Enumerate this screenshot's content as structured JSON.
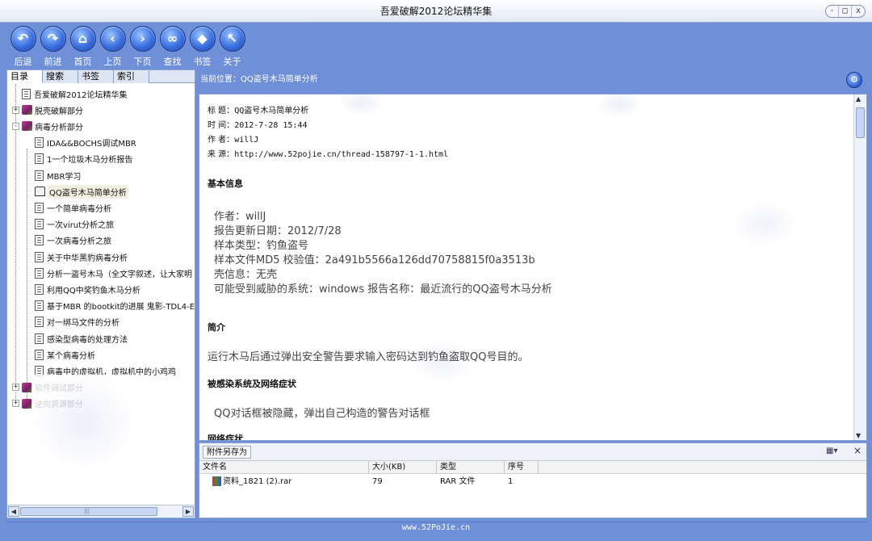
{
  "window": {
    "title": "吾爱破解2012论坛精华集",
    "controls": [
      "-",
      "□",
      "x"
    ]
  },
  "toolbar": [
    {
      "label": "后退",
      "icon": "back-icon",
      "glyph": "↶"
    },
    {
      "label": "前进",
      "icon": "forward-icon",
      "glyph": "↷"
    },
    {
      "label": "首页",
      "icon": "home-icon",
      "glyph": "⌂"
    },
    {
      "label": "上页",
      "icon": "prev-page-icon",
      "glyph": "‹"
    },
    {
      "label": "下页",
      "icon": "next-page-icon",
      "glyph": "›"
    },
    {
      "label": "查找",
      "icon": "binoculars-icon",
      "glyph": "∞"
    },
    {
      "label": "书签",
      "icon": "bookmark-icon",
      "glyph": "◆"
    },
    {
      "label": "关于",
      "icon": "about-icon",
      "glyph": "↖"
    }
  ],
  "left": {
    "tabs": [
      "目录",
      "搜索",
      "书签",
      "索引"
    ],
    "tree": [
      {
        "label": "吾爱破解2012论坛精华集",
        "type": "doc",
        "level": 0,
        "expander": ""
      },
      {
        "label": "脱壳破解部分",
        "type": "book",
        "level": 0,
        "expander": "+"
      },
      {
        "label": "病毒分析部分",
        "type": "book",
        "level": 0,
        "expander": "-"
      },
      {
        "label": "IDA&&BOCHS调试MBR",
        "type": "doc",
        "level": 1,
        "expander": ""
      },
      {
        "label": "1一个垃圾木马分析报告",
        "type": "doc",
        "level": 1,
        "expander": ""
      },
      {
        "label": "MBR学习",
        "type": "doc",
        "level": 1,
        "expander": ""
      },
      {
        "label": "QQ盗号木马简单分析",
        "type": "open",
        "level": 1,
        "expander": "",
        "selected": true
      },
      {
        "label": "一个简单病毒分析",
        "type": "doc",
        "level": 1,
        "expander": ""
      },
      {
        "label": "一次virut分析之旅",
        "type": "doc",
        "level": 1,
        "expander": ""
      },
      {
        "label": "一次病毒分析之旅",
        "type": "doc",
        "level": 1,
        "expander": ""
      },
      {
        "label": "关于中华黑豹病毒分析",
        "type": "doc",
        "level": 1,
        "expander": ""
      },
      {
        "label": "分析一盗号木马（全文字叙述，让大家明",
        "type": "doc",
        "level": 1,
        "expander": ""
      },
      {
        "label": "利用QQ中奖钓鱼木马分析",
        "type": "doc",
        "level": 1,
        "expander": ""
      },
      {
        "label": "基于MBR 的bootkit的进展 鬼影-TDL4-E",
        "type": "doc",
        "level": 1,
        "expander": ""
      },
      {
        "label": "对一绑马文件的分析",
        "type": "doc",
        "level": 1,
        "expander": ""
      },
      {
        "label": "感染型病毒的处理方法",
        "type": "doc",
        "level": 1,
        "expander": ""
      },
      {
        "label": "某个病毒分析",
        "type": "doc",
        "level": 1,
        "expander": ""
      },
      {
        "label": "病毒中的虚拟机，虚拟机中的小鸡鸡",
        "type": "doc",
        "level": 1,
        "expander": ""
      },
      {
        "label": "软件调试部分",
        "type": "book",
        "level": 0,
        "expander": "+"
      },
      {
        "label": "逆向资源部分",
        "type": "book",
        "level": 0,
        "expander": "+"
      }
    ],
    "hscroll": {
      "left": "◀",
      "right": "▶",
      "grip": "|||"
    }
  },
  "location": {
    "text": "当前位置：QQ盗号木马简单分析"
  },
  "article": {
    "meta": [
      {
        "k": "标  题：",
        "v": "QQ盗号木马简单分析"
      },
      {
        "k": "时  间：",
        "v": "2012-7-28 15:44"
      },
      {
        "k": "作  者：",
        "v": "willJ"
      },
      {
        "k": "来  源：",
        "v": "http://www.52pojie.cn/thread-158797-1-1.html"
      }
    ],
    "s1_title": "基本信息",
    "info": [
      "作者：willJ",
      "报告更新日期：2012/7/28",
      "样本类型：钓鱼盗号",
      "样本文件MD5 校验值：2a491b5566a126dd70758815f0a3513b",
      "壳信息：无壳",
      "可能受到威胁的系统：windows  报告名称：最近流行的QQ盗号木马分析"
    ],
    "s2_title": "简介",
    "s2_text": "运行木马后通过弹出安全警告要求输入密码达到钓鱼盗取QQ号目的。",
    "s3_title": "被感染系统及网络症状",
    "s3_text": "QQ对话框被隐藏，弹出自己构造的警告对话框",
    "s4_title": "网络症状"
  },
  "attach": {
    "save_label": "附件另存为",
    "view_icon": "▦▾",
    "close": "×",
    "columns": [
      "文件名",
      "大小(KB)",
      "类型",
      "序号"
    ],
    "rows": [
      {
        "name": "资料_1821 (2).rar",
        "size": "79",
        "type": "RAR 文件",
        "index": "1"
      }
    ]
  },
  "status": {
    "text": "www.52PoJie.cn"
  },
  "colors": {
    "chrome": "#6f8fd8",
    "border": "#8aa0cc"
  }
}
